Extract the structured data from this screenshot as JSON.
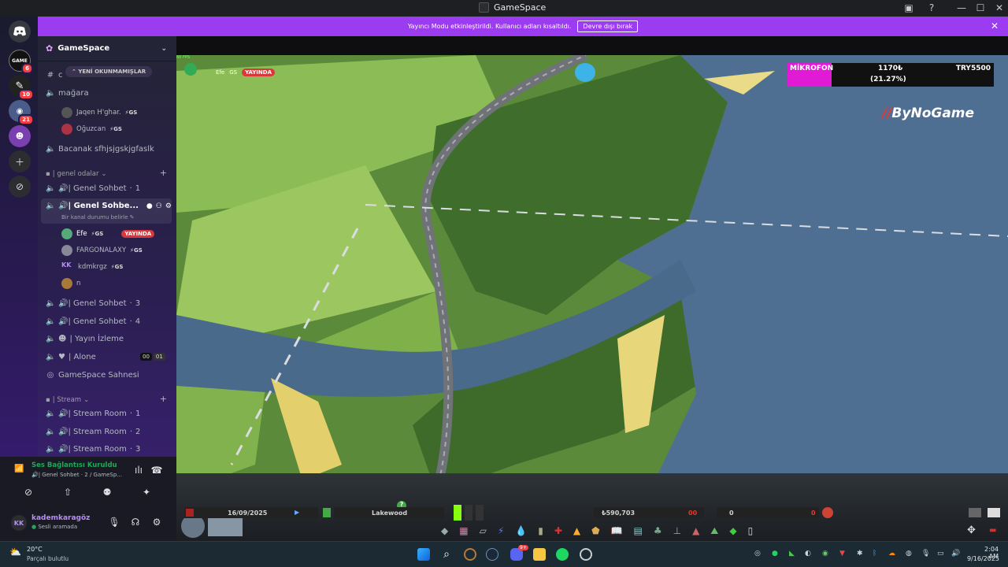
{
  "window": {
    "title": "GameSpace",
    "controls": [
      "—",
      "☐",
      "✕"
    ]
  },
  "banner": {
    "message": "Yayıncı Modu etkinleştirildi. Kullanıcı adları kısaltıldı.",
    "button": "Devre dışı bırak",
    "close": "✕"
  },
  "rail": {
    "badges": [
      "6",
      "10",
      "21"
    ]
  },
  "server": {
    "name": "GameSpace",
    "unread_pill": "YENİ OKUNMAMIŞLAR",
    "channels": {
      "top_partial": "c",
      "magara": "mağara",
      "bacanak": "Bacanak sfhjsjgskjgfaslk",
      "genel_category": "| genel odalar",
      "genel1": "🔊| Genel Sohbet",
      "genel1_count": "1",
      "genel2": "🔊| Genel Sohbe...",
      "genel2_status": "Bir kanal durumu belirle",
      "genel3": "🔊| Genel Sohbet",
      "genel3_count": "3",
      "genel4": "🔊| Genel Sohbet",
      "genel4_count": "4",
      "yayin": "| Yayın İzleme",
      "alone": "| Alone",
      "alone_a": "00",
      "alone_b": "01",
      "sahne": "GameSpace Sahnesi",
      "stream_category": "| Stream",
      "stream1": "🔊| Stream Room",
      "stream1_count": "1",
      "stream2": "🔊| Stream Room",
      "stream2_count": "2",
      "stream3": "🔊| Stream Room",
      "stream3_count": "3"
    },
    "magara_users": [
      {
        "name": "Jaqen H'ghar.",
        "tag": "GS"
      },
      {
        "name": "Oğuzcan",
        "tag": "GS"
      }
    ],
    "genel2_users": [
      {
        "name": "Efe",
        "tag": "GS",
        "live": "YAYINDA"
      },
      {
        "name": "FARGONALAXY",
        "tag": "GS"
      },
      {
        "name": "kdmkrgz",
        "tag": "GS",
        "initials": "KK"
      },
      {
        "name": "n"
      }
    ]
  },
  "voice": {
    "status": "Ses Bağlantısı Kuruldu",
    "channel": "🔊| Genel Sohbet · 2 / GameSp...",
    "username": "kademkaragöz",
    "user_status": "Sesli aramada",
    "initials": "KK"
  },
  "game": {
    "viewer_user": "Efe",
    "viewer_tag": "GS",
    "viewer_live": "YAYINDA",
    "fps": "60 FPS",
    "overlay": {
      "label": "MİKROFON",
      "amount": "1170₺",
      "percent": "(21.27%)",
      "goal": "TRY5500",
      "progress": 0.2127
    },
    "brand": "ByNoGame",
    "hud": {
      "date": "16/09/2025",
      "city": "Lakewood",
      "money": "₺590,703",
      "money_delta": "00",
      "population": "0",
      "pop_delta": "0"
    }
  },
  "taskbar": {
    "weather_temp": "20°C",
    "weather_desc": "Parçalı bulutlu",
    "time": "2:04 AM",
    "date": "9/16/2025",
    "notification_badge": "9+"
  },
  "colors": {
    "accent": "#9b3cf0",
    "live": "#da373c",
    "voice_green": "#23a55a",
    "overlay_pink": "#e11ad5"
  }
}
